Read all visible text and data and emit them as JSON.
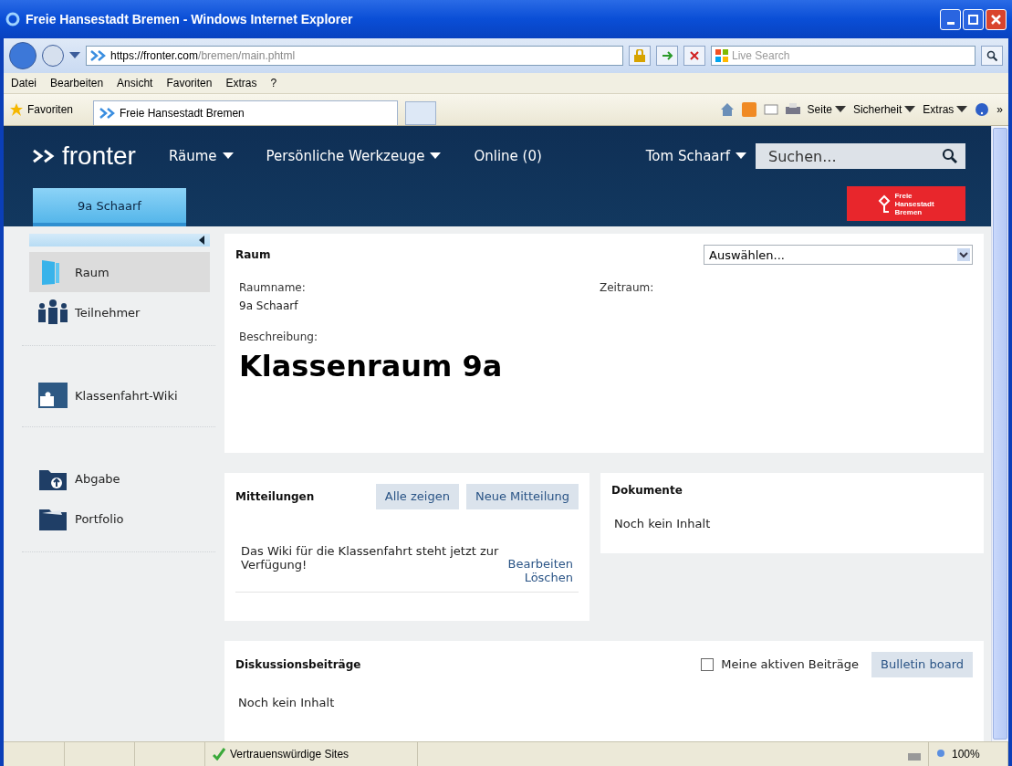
{
  "window": {
    "title": "Freie Hansestadt Bremen - Windows Internet Explorer"
  },
  "address_bar": {
    "host": "https://fronter.com",
    "path": "/bremen/main.phtml",
    "search_placeholder": "Live Search"
  },
  "menu": [
    "Datei",
    "Bearbeiten",
    "Ansicht",
    "Favoriten",
    "Extras",
    "?"
  ],
  "favorites_bar": {
    "label": "Favoriten",
    "tab": "Freie Hansestadt Bremen",
    "commands": [
      "Seite",
      "Sicherheit",
      "Extras"
    ],
    "more": "»"
  },
  "header": {
    "logo": "fronter",
    "nav": [
      {
        "label": "Räume",
        "kind": "dropdown"
      },
      {
        "label": "Persönliche Werkzeuge",
        "kind": "dropdown"
      },
      {
        "label": "Online (0)",
        "kind": "plain"
      }
    ],
    "user": "Tom Schaarf",
    "search_placeholder": "Suchen...",
    "room_tabs": [
      {
        "label": "9a Schaarf",
        "selected": true
      }
    ],
    "badge": [
      "Freie",
      "Hansestadt",
      "Bremen"
    ]
  },
  "sidebar": {
    "groups": [
      [
        {
          "label": "Raum",
          "kind": "room",
          "selected": true
        },
        {
          "label": "Teilnehmer",
          "kind": "members",
          "selected": false
        }
      ],
      [
        {
          "label": "Klassenfahrt-Wiki",
          "kind": "wiki",
          "selected": false
        }
      ],
      [
        {
          "label": "Abgabe",
          "kind": "handin",
          "selected": false
        },
        {
          "label": "Portfolio",
          "kind": "portfolio",
          "selected": false
        }
      ]
    ]
  },
  "room_panel": {
    "title": "Raum",
    "select": "Auswählen...",
    "name_label": "Raumname:",
    "name_value": "9a Schaarf",
    "period_label": "Zeitraum:",
    "description_label": "Beschreibung:",
    "description": "Klassenraum 9a"
  },
  "messages_panel": {
    "title": "Mitteilungen",
    "buttons": [
      "Alle zeigen",
      "Neue Mitteilung"
    ],
    "items": [
      {
        "text": "Das Wiki für die Klassenfahrt steht jetzt zur Verfügung!",
        "actions": [
          "Bearbeiten",
          "Löschen"
        ]
      }
    ]
  },
  "documents_panel": {
    "title": "Dokumente",
    "empty": "Noch kein Inhalt"
  },
  "discussion_panel": {
    "title": "Diskussionsbeiträge",
    "filter": {
      "label": "Meine aktiven Beiträge",
      "checked": false
    },
    "button": "Bulletin board",
    "empty": "Noch kein Inhalt"
  },
  "status_bar": {
    "zone": "Vertrauenswürdige Sites",
    "zoom": "100%"
  }
}
